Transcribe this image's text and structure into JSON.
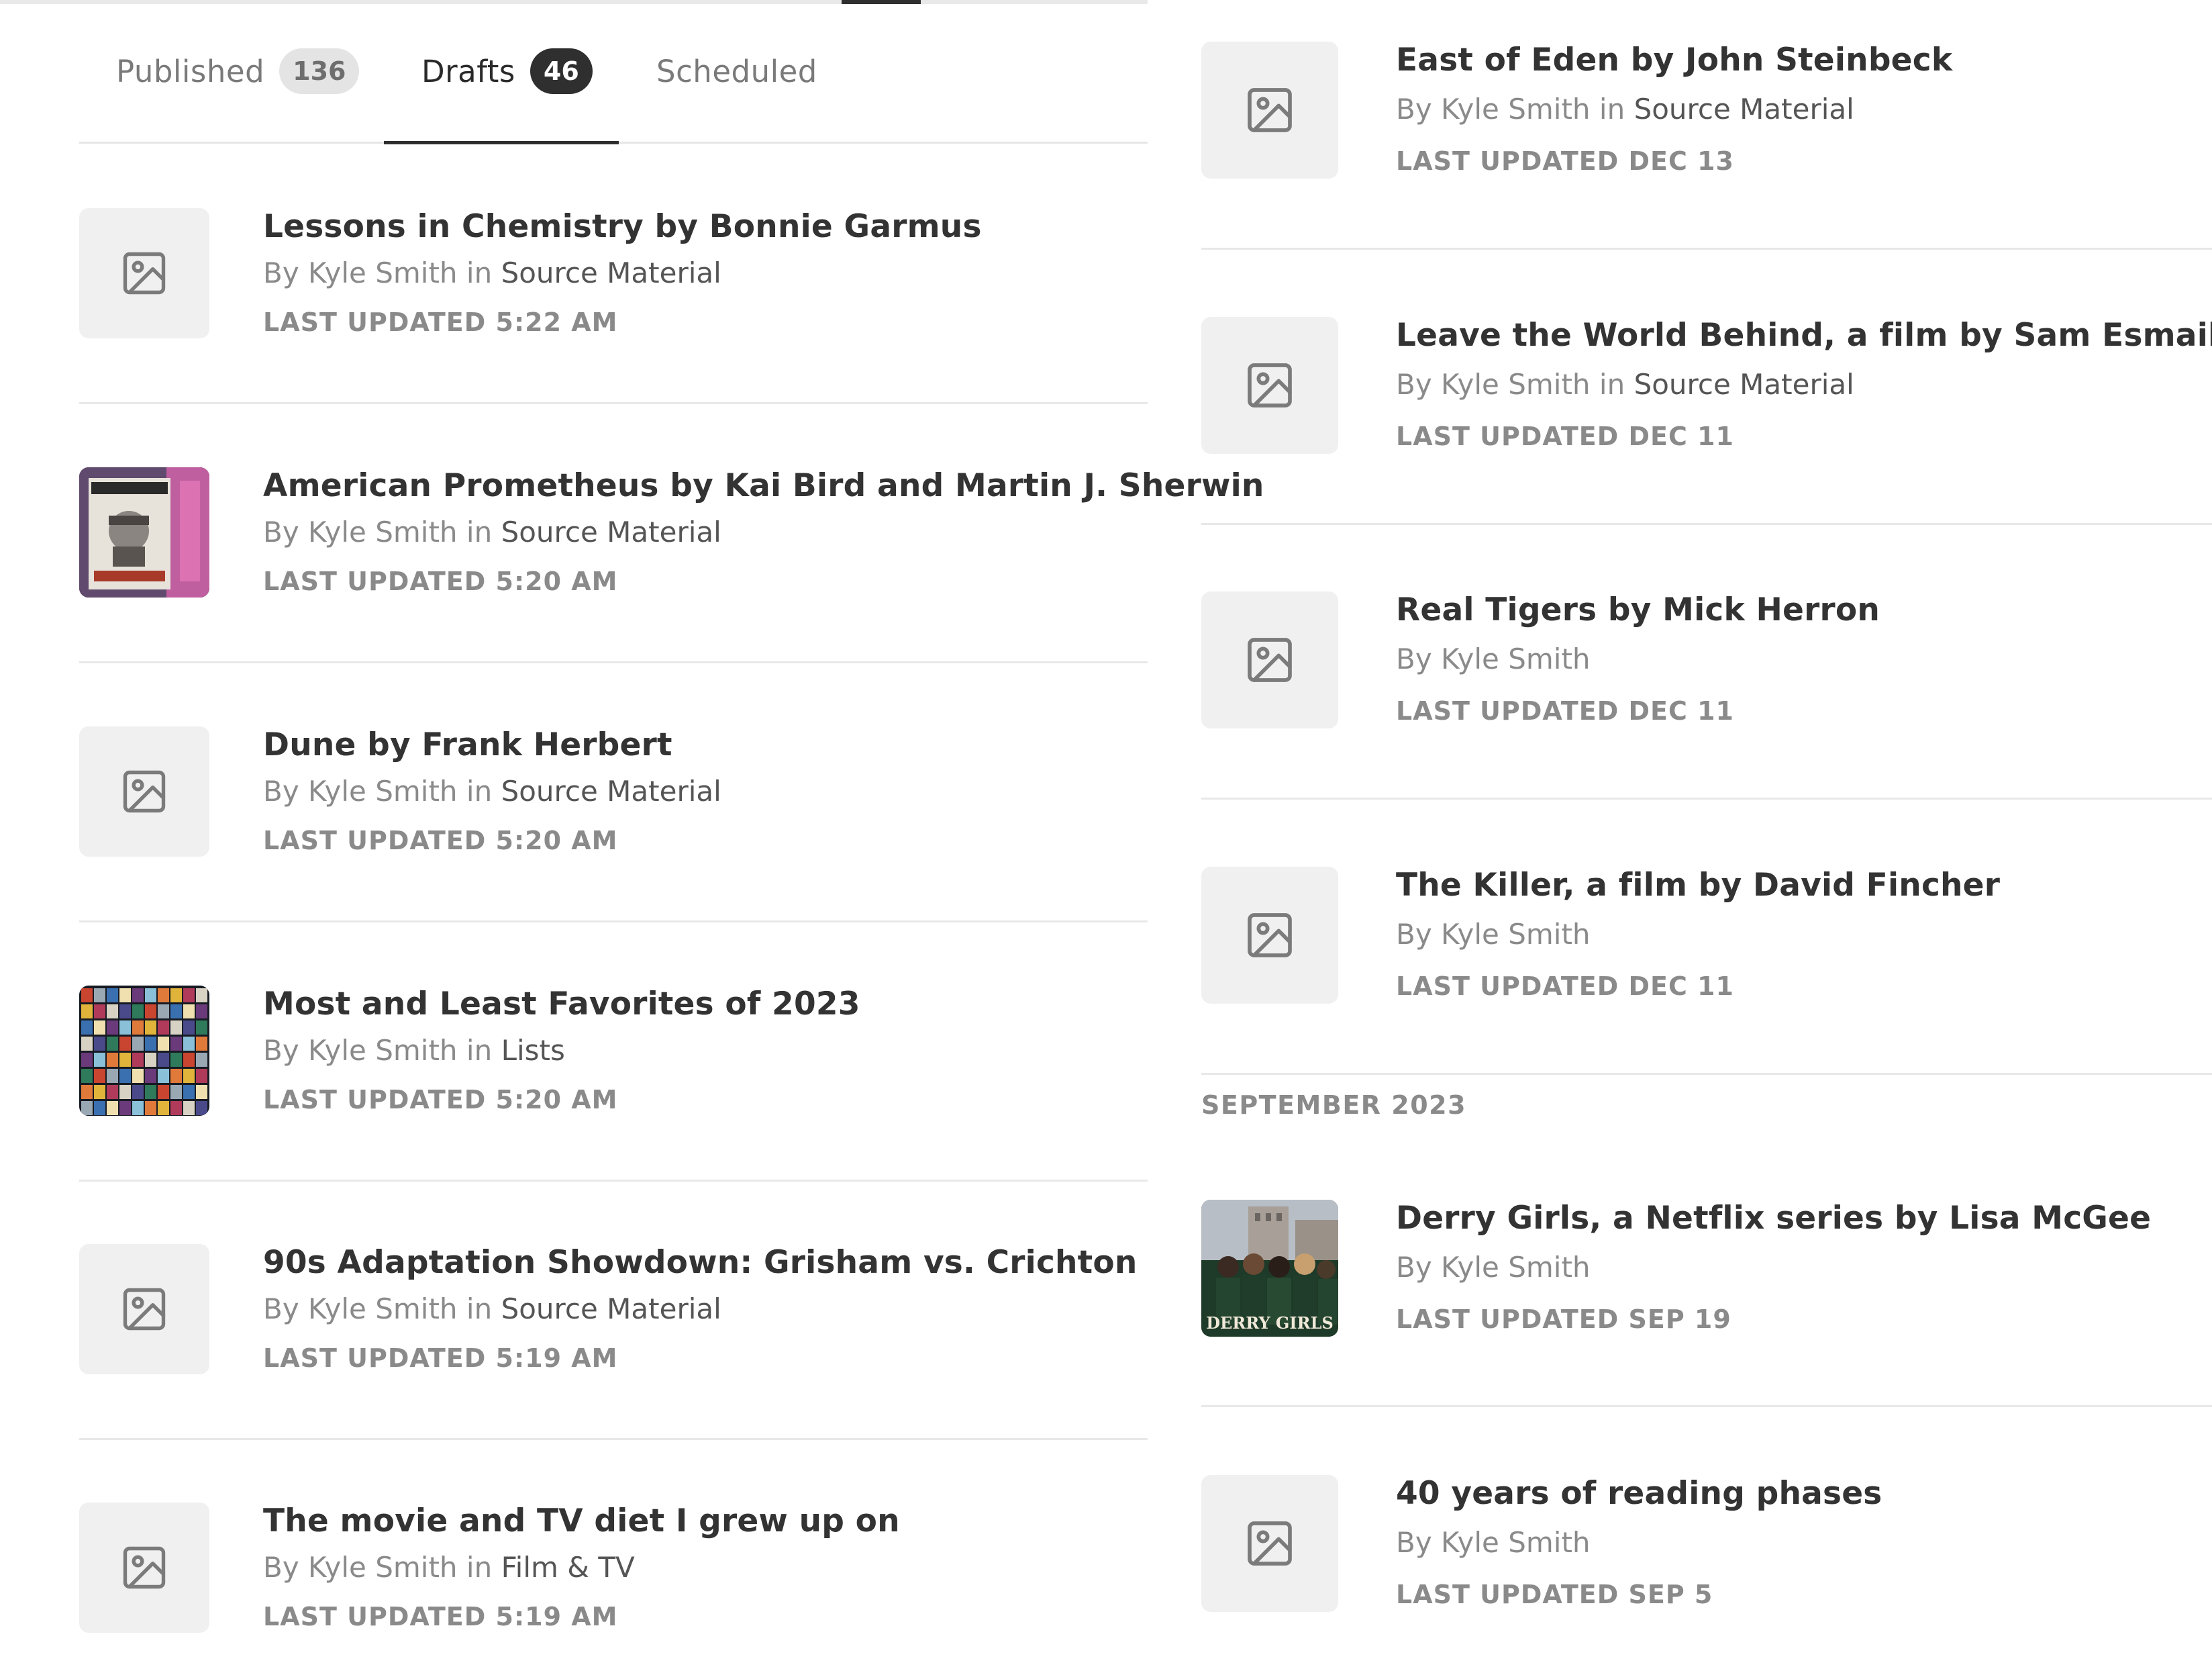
{
  "tabs": [
    {
      "label": "Published",
      "count": "136"
    },
    {
      "label": "Drafts",
      "count": "46"
    },
    {
      "label": "Scheduled"
    }
  ],
  "left_items": [
    {
      "title": "Lessons in Chemistry by Bonnie Garmus",
      "author_prefix": "By Kyle Smith",
      "in_word": " in ",
      "category": "Source Material",
      "updated": "LAST UPDATED 5:22 AM",
      "thumb": "placeholder-image-icon"
    },
    {
      "title": "American Prometheus by Kai Bird and Martin J. Sherwin",
      "author_prefix": "By Kyle Smith",
      "in_word": " in ",
      "category": "Source Material",
      "updated": "LAST UPDATED 5:20 AM",
      "thumb": "book-cover-image"
    },
    {
      "title": "Dune by Frank Herbert",
      "author_prefix": "By Kyle Smith",
      "in_word": " in ",
      "category": "Source Material",
      "updated": "LAST UPDATED 5:20 AM",
      "thumb": "placeholder-image-icon"
    },
    {
      "title": "Most and Least Favorites of 2023",
      "author_prefix": "By Kyle Smith",
      "in_word": " in ",
      "category": "Lists",
      "updated": "LAST UPDATED 5:20 AM",
      "thumb": "poster-grid-image"
    },
    {
      "title": "90s Adaptation Showdown: Grisham vs. Crichton",
      "author_prefix": "By Kyle Smith",
      "in_word": " in ",
      "category": "Source Material",
      "updated": "LAST UPDATED 5:19 AM",
      "thumb": "placeholder-image-icon"
    },
    {
      "title": "The movie and TV diet I grew up on",
      "author_prefix": "By Kyle Smith",
      "in_word": " in ",
      "category": "Film & TV",
      "updated": "LAST UPDATED 5:19 AM",
      "thumb": "placeholder-image-icon"
    }
  ],
  "right_items": [
    {
      "title": "East of Eden by John Steinbeck",
      "author_prefix": "By Kyle Smith",
      "in_word": " in ",
      "category": "Source Material",
      "updated": "LAST UPDATED DEC 13",
      "thumb": "placeholder-image-icon"
    },
    {
      "title": "Leave the World Behind, a film by Sam Esmail",
      "author_prefix": "By Kyle Smith",
      "in_word": " in ",
      "category": "Source Material",
      "updated": "LAST UPDATED DEC 11",
      "thumb": "placeholder-image-icon"
    },
    {
      "title": "Real Tigers by Mick Herron",
      "author_prefix": "By Kyle Smith",
      "in_word": "",
      "category": "",
      "updated": "LAST UPDATED DEC 11",
      "thumb": "placeholder-image-icon"
    },
    {
      "title": "The Killer, a film by David Fincher",
      "author_prefix": "By Kyle Smith",
      "in_word": "",
      "category": "",
      "updated": "LAST UPDATED DEC 11",
      "thumb": "placeholder-image-icon"
    },
    {
      "title": "Derry Girls, a Netflix series by Lisa McGee",
      "author_prefix": "By Kyle Smith",
      "in_word": "",
      "category": "",
      "updated": "LAST UPDATED SEP 19",
      "thumb": "show-poster-image",
      "thumb_text": "DERRY GIRLS"
    },
    {
      "title": "40 years of reading phases",
      "author_prefix": "By Kyle Smith",
      "in_word": "",
      "category": "",
      "updated": "LAST UPDATED SEP 5",
      "thumb": "placeholder-image-icon"
    }
  ],
  "section_header": "SEPTEMBER 2023",
  "colors": {
    "accent": "#2f2f2f",
    "muted": "#8a8a8a",
    "placeholder_bg": "#f0f0f0"
  }
}
